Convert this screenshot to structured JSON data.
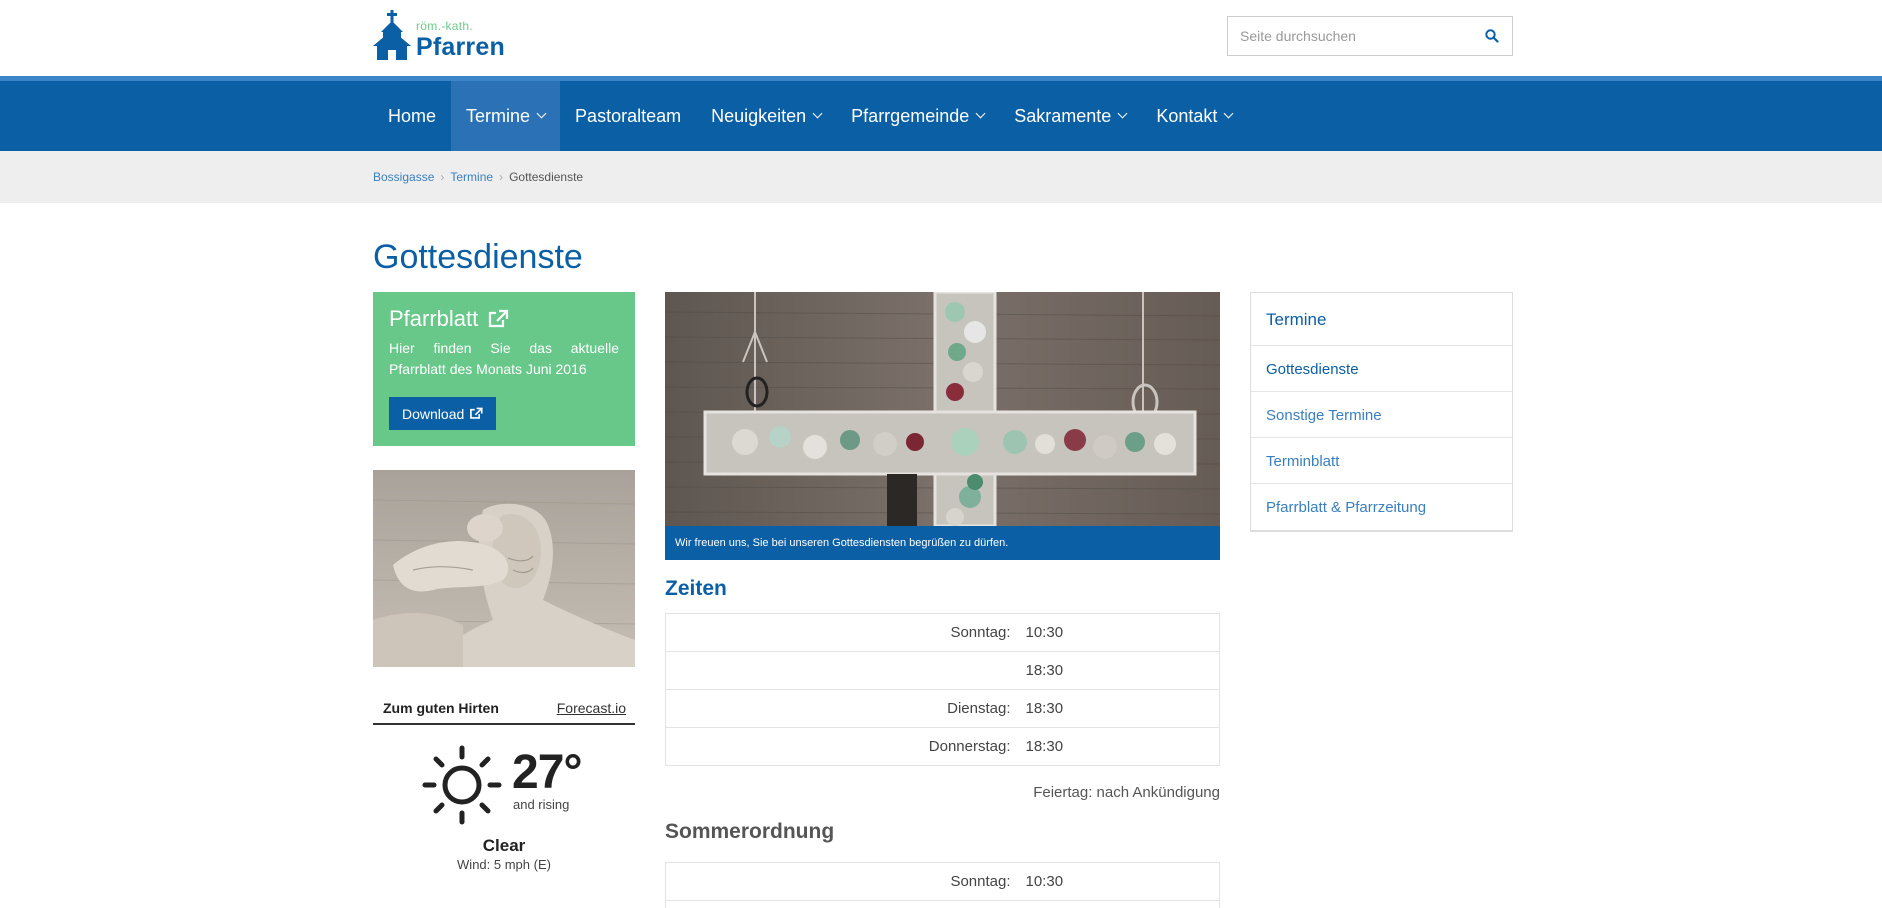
{
  "logo": {
    "small": "röm.-kath.",
    "big": "Pfarren"
  },
  "search": {
    "placeholder": "Seite durchsuchen"
  },
  "nav": {
    "items": [
      {
        "label": "Home",
        "dropdown": false,
        "active": false
      },
      {
        "label": "Termine",
        "dropdown": true,
        "active": true
      },
      {
        "label": "Pastoralteam",
        "dropdown": false,
        "active": false
      },
      {
        "label": "Neuigkeiten",
        "dropdown": true,
        "active": false
      },
      {
        "label": "Pfarrgemeinde",
        "dropdown": true,
        "active": false
      },
      {
        "label": "Sakramente",
        "dropdown": true,
        "active": false
      },
      {
        "label": "Kontakt",
        "dropdown": true,
        "active": false
      }
    ]
  },
  "breadcrumb": {
    "items": [
      "Bossigasse",
      "Termine"
    ],
    "current": "Gottesdienste"
  },
  "page": {
    "title": "Gottesdienste"
  },
  "pfarrblatt": {
    "title": "Pfarrblatt",
    "text": "Hier finden Sie das aktuelle Pfarrblatt des Monats Juni 2016",
    "button": "Download"
  },
  "weather": {
    "location": "Zum guten Hirten",
    "source": "Forecast.io",
    "temperature": "27°",
    "trend": "and rising",
    "condition": "Clear",
    "wind": "Wind: 5 mph (E)"
  },
  "hero": {
    "caption": "Wir freuen uns, Sie bei unseren Gottesdiensten begrüßen zu dürfen."
  },
  "zeiten": {
    "title": "Zeiten",
    "rows": [
      {
        "day": "Sonntag:",
        "time": "10:30"
      },
      {
        "day": "",
        "time": "18:30"
      },
      {
        "day": "Dienstag:",
        "time": "18:30"
      },
      {
        "day": "Donnerstag:",
        "time": "18:30"
      }
    ],
    "note": "Feiertag: nach Ankündigung"
  },
  "sommer": {
    "title": "Sommerordnung",
    "rows": [
      {
        "day": "Sonntag:",
        "time": "10:30"
      },
      {
        "day": "",
        "time": ""
      }
    ]
  },
  "sidebar": {
    "title": "Termine",
    "items": [
      "Gottesdienste",
      "Sonstige Termine",
      "Terminblatt",
      "Pfarrblatt & Pfarrzeitung"
    ]
  },
  "colors": {
    "brand_blue": "#0b5fa5",
    "green": "#68c88a",
    "link": "#3a7fbf"
  }
}
